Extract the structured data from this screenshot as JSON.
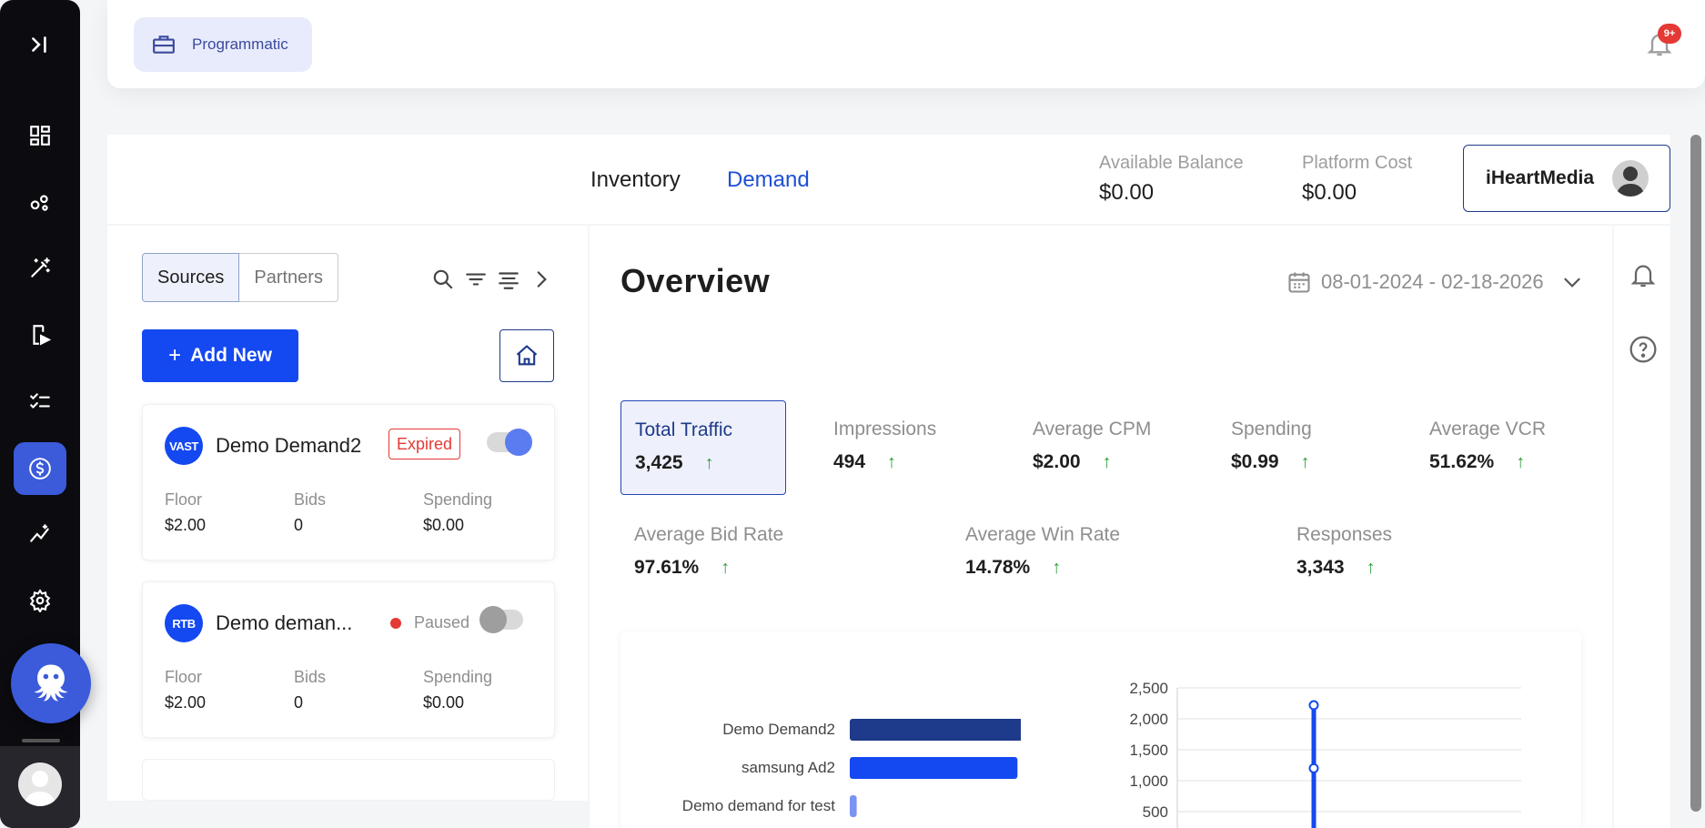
{
  "sidebar": {
    "items": [
      {
        "name": "expand-icon"
      },
      {
        "name": "dashboard-icon"
      },
      {
        "name": "network-icon"
      },
      {
        "name": "magic-wand-icon"
      },
      {
        "name": "video-player-icon"
      },
      {
        "name": "checklist-icon"
      },
      {
        "name": "dollar-icon",
        "active": true
      },
      {
        "name": "analytics-icon"
      },
      {
        "name": "settings-icon"
      }
    ]
  },
  "topbar": {
    "module_label": "Programmatic",
    "notification_badge": "9+"
  },
  "header": {
    "tabs": [
      {
        "label": "Inventory"
      },
      {
        "label": "Demand",
        "active": true
      }
    ],
    "available_balance_label": "Available Balance",
    "available_balance_value": "$0.00",
    "platform_cost_label": "Platform Cost",
    "platform_cost_value": "$0.00",
    "account_name": "iHeartMedia"
  },
  "left_panel": {
    "segments": [
      {
        "label": "Sources",
        "active": true
      },
      {
        "label": "Partners"
      }
    ],
    "add_button_label": "Add New",
    "cards": [
      {
        "badge": "VAST",
        "title": "Demo Demand2",
        "status": "Expired",
        "enabled": true,
        "stats": [
          {
            "label": "Floor",
            "value": "$2.00"
          },
          {
            "label": "Bids",
            "value": "0"
          },
          {
            "label": "Spending",
            "value": "$0.00"
          }
        ]
      },
      {
        "badge": "RTB",
        "title": "Demo deman...",
        "status": "Paused",
        "enabled": false,
        "stats": [
          {
            "label": "Floor",
            "value": "$2.00"
          },
          {
            "label": "Bids",
            "value": "0"
          },
          {
            "label": "Spending",
            "value": "$0.00"
          }
        ]
      }
    ]
  },
  "main": {
    "title": "Overview",
    "date_range": "08-01-2024 - 02-18-2026",
    "metrics_row1": [
      {
        "label": "Total Traffic",
        "value": "3,425",
        "selected": true
      },
      {
        "label": "Impressions",
        "value": "494"
      },
      {
        "label": "Average CPM",
        "value": "$2.00"
      },
      {
        "label": "Spending",
        "value": "$0.99"
      },
      {
        "label": "Average VCR",
        "value": "51.62%"
      }
    ],
    "metrics_row2": [
      {
        "label": "Average Bid Rate",
        "value": "97.61%"
      },
      {
        "label": "Average Win Rate",
        "value": "14.78%"
      },
      {
        "label": "Responses",
        "value": "3,343"
      }
    ],
    "trend_arrow": "↑"
  },
  "chart_data": [
    {
      "type": "bar",
      "orientation": "horizontal",
      "categories": [
        "Demo Demand2",
        "samsung Ad2",
        "Demo demand for test"
      ],
      "values": [
        100,
        97,
        4
      ],
      "colors": [
        "#1e3a8a",
        "#1448f0",
        "#7b93f5"
      ]
    },
    {
      "type": "line",
      "y_ticks": [
        "2,500",
        "2,000",
        "1,500",
        "1,000",
        "500"
      ],
      "ylim": [
        0,
        2500
      ],
      "x": [
        0,
        1,
        2
      ],
      "values": [
        0,
        1200,
        2220
      ],
      "grid": true
    }
  ]
}
